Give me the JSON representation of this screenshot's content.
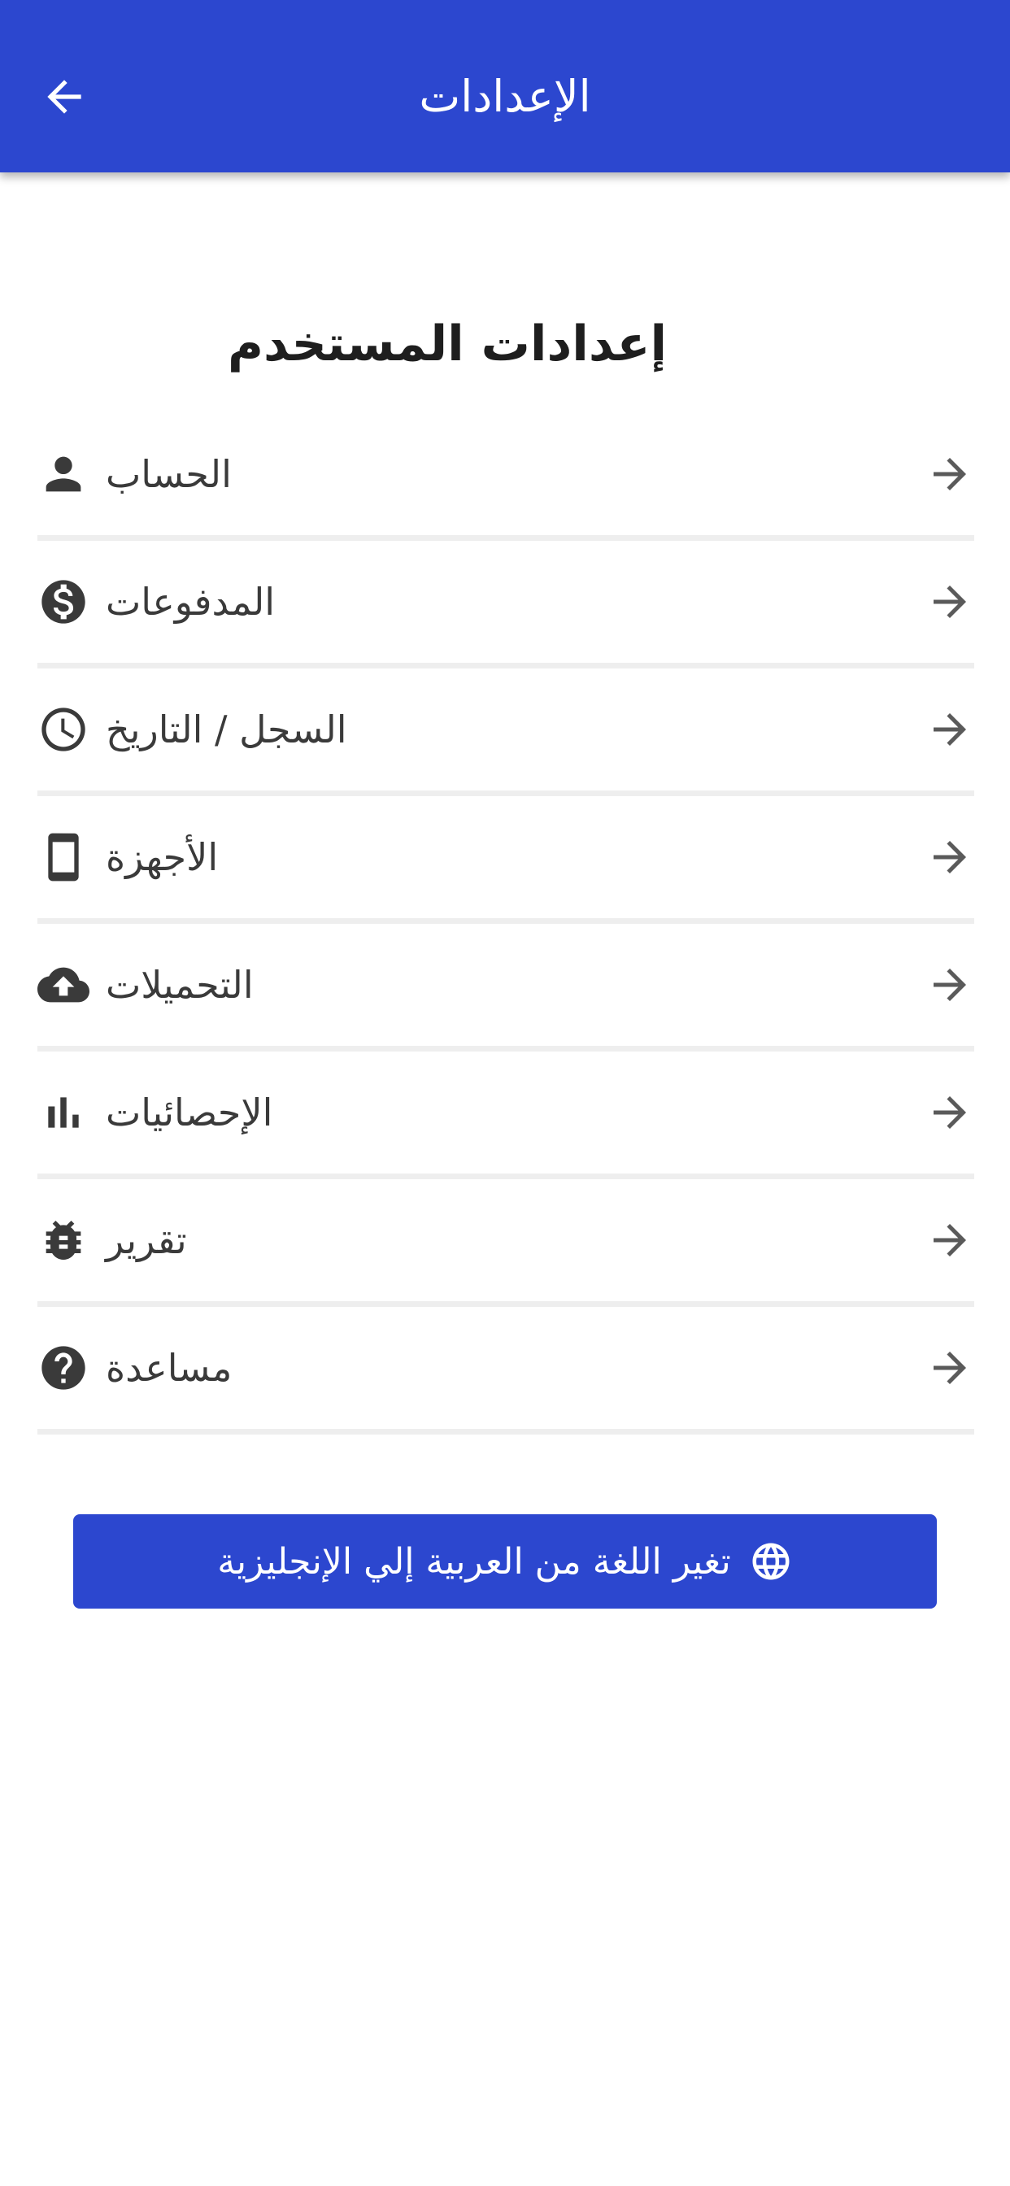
{
  "app_bar": {
    "title": "الإعدادات",
    "back_icon": "arrow-left-icon"
  },
  "section": {
    "title": "إعدادات المستخدم"
  },
  "menu": {
    "items": [
      {
        "label": "الحساب",
        "icon": "person-icon"
      },
      {
        "label": "المدفوعات",
        "icon": "dollar-circle-icon"
      },
      {
        "label": "السجل / التاريخ",
        "icon": "clock-icon"
      },
      {
        "label": "الأجهزة",
        "icon": "phone-device-icon"
      },
      {
        "label": "التحميلات",
        "icon": "cloud-upload-icon"
      },
      {
        "label": "الإحصائيات",
        "icon": "bar-chart-icon"
      },
      {
        "label": "تقرير",
        "icon": "bug-icon"
      },
      {
        "label": "مساعدة",
        "icon": "help-circle-icon"
      }
    ],
    "row_arrow_icon": "arrow-right-icon"
  },
  "language_button": {
    "label": "تغير اللغة من العربية إلي الإنجليزية",
    "icon": "globe-icon"
  },
  "colors": {
    "primary": "#2c47cf",
    "icon": "#3a3a3a",
    "divider": "#eeeeee",
    "text": "#1e1e1e"
  }
}
